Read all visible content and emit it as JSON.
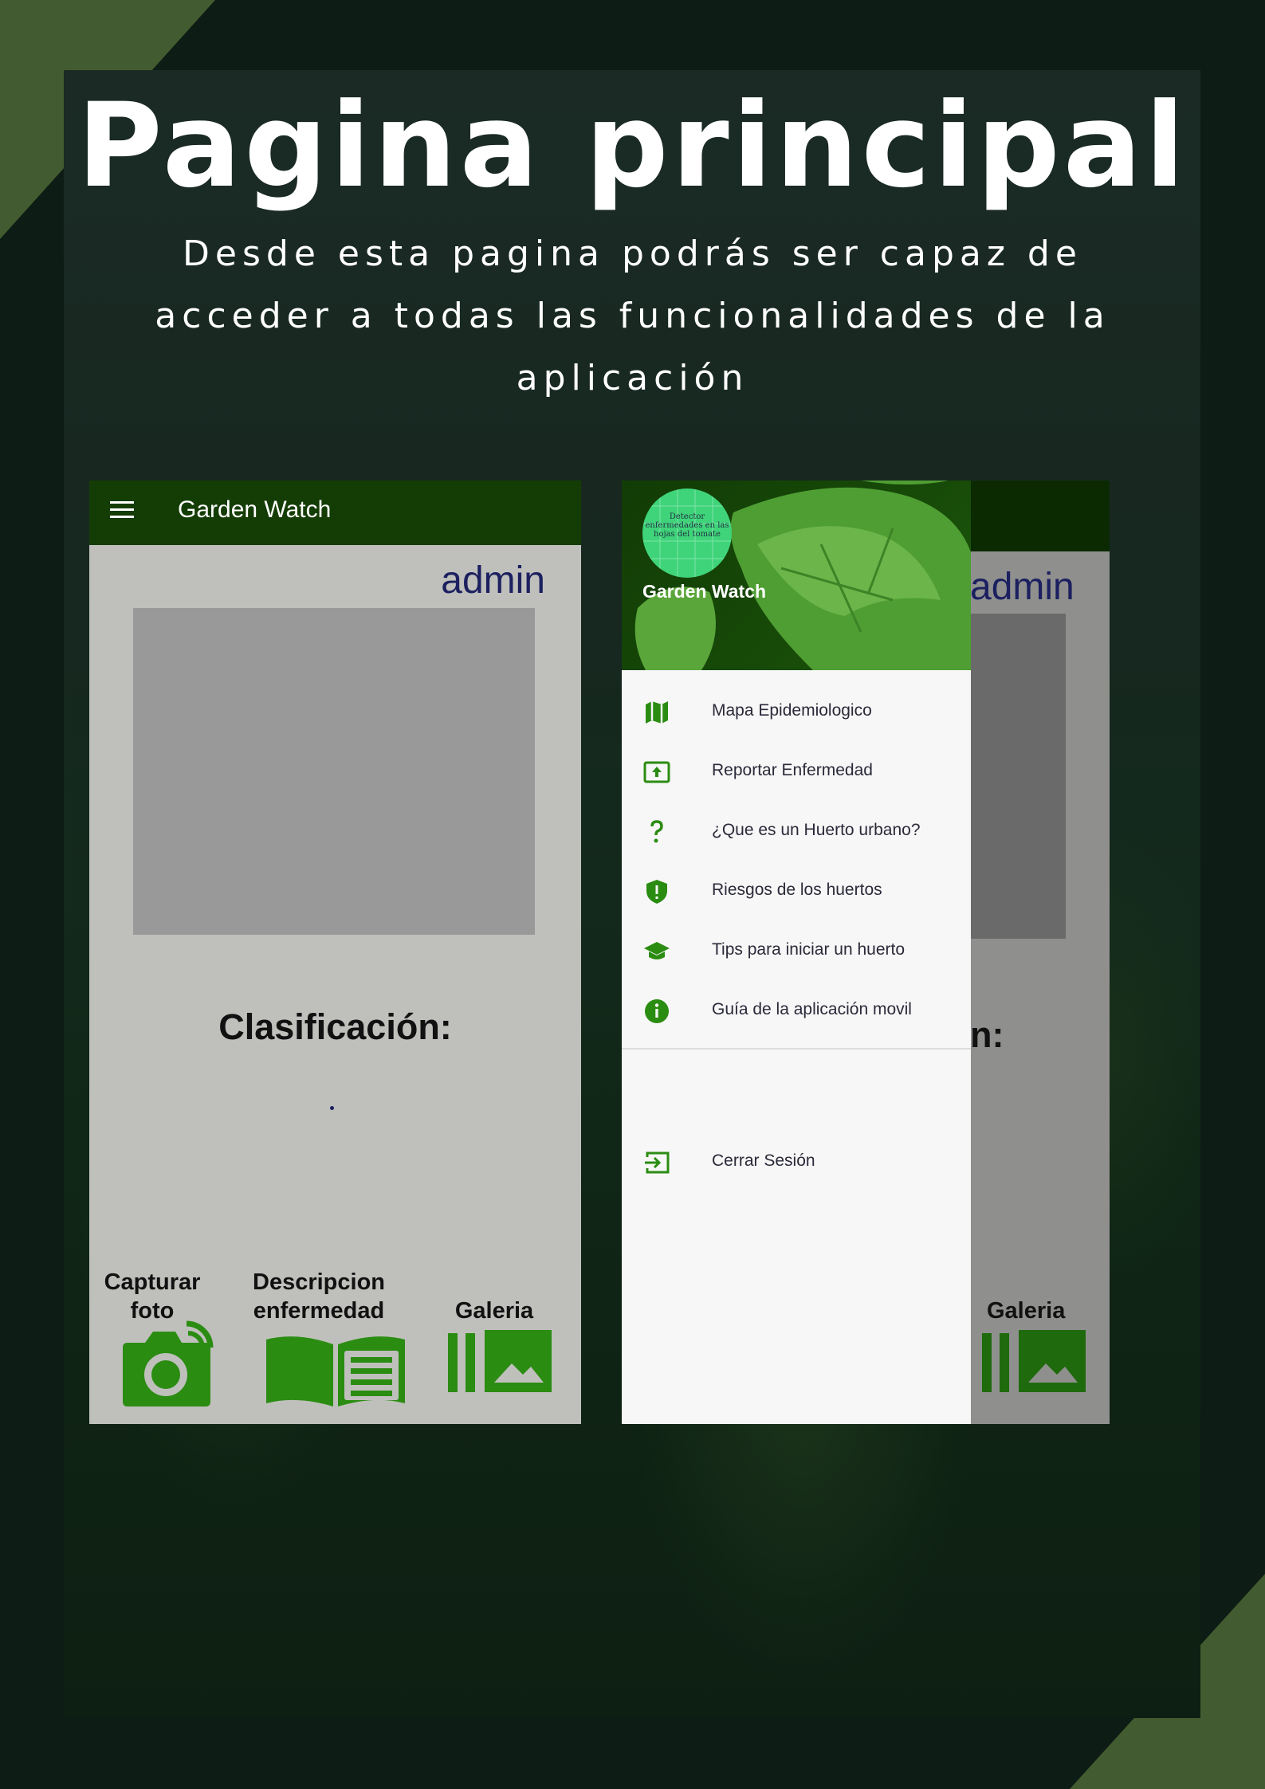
{
  "page": {
    "title": "Pagina principal",
    "subtitle": "Desde esta pagina podrás ser capaz de acceder a todas las funcionalidades de la aplicación"
  },
  "colors": {
    "accent_green": "#2b8c12",
    "appbar_dark_green": "#143d05",
    "username_navy": "#1c2060"
  },
  "main_screen": {
    "app_title": "Garden Watch",
    "menu_icon": "hamburger-icon",
    "user": "admin",
    "classification_label": "Clasificación:",
    "classification_value": ".",
    "actions": [
      {
        "label": "Capturar foto",
        "icon": "camera-icon"
      },
      {
        "label": "Descripcion enfermedad",
        "icon": "book-icon"
      },
      {
        "label": "Galeria",
        "icon": "gallery-icon"
      }
    ]
  },
  "drawer_screen": {
    "app_title": "Garden Watch",
    "logo_text": "Detector enfermedades en las hojas del tomate",
    "background_user": "admin",
    "background_classification": "n:",
    "background_gallery": "Galeria",
    "items": [
      {
        "label": "Mapa Epidemiologico",
        "icon": "map-icon"
      },
      {
        "label": "Reportar Enfermedad",
        "icon": "upload-icon"
      },
      {
        "label": "¿Que es un Huerto urbano?",
        "icon": "question-icon"
      },
      {
        "label": "Riesgos de los huertos",
        "icon": "shield-icon"
      },
      {
        "label": "Tips para iniciar un huerto",
        "icon": "school-icon"
      },
      {
        "label": "Guía de la aplicación movil",
        "icon": "info-icon"
      }
    ],
    "logout": {
      "label": "Cerrar Sesión",
      "icon": "logout-icon"
    }
  }
}
